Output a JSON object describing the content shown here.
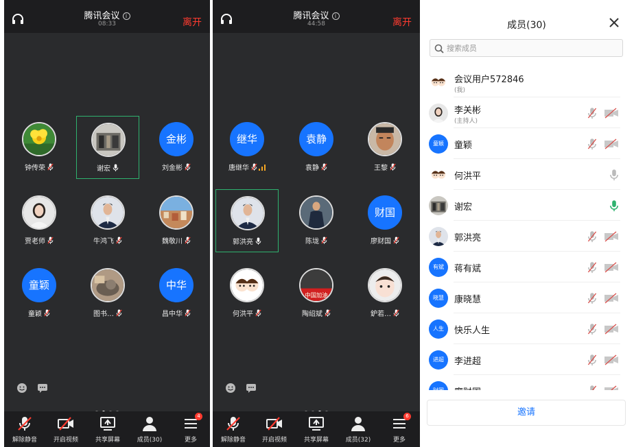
{
  "screen1": {
    "title": "腾讯会议",
    "time": "08:33",
    "leave_label": "离开",
    "participants": [
      {
        "name": "钟传荣",
        "avatar": "flower"
      },
      {
        "name": "谢宏",
        "avatar": "building"
      },
      {
        "name": "刘金彬",
        "avatar_text": "金彬"
      },
      {
        "name": "贾老师",
        "avatar": "woman"
      },
      {
        "name": "牛鸿飞",
        "avatar": "man-suit"
      },
      {
        "name": "魏敬川",
        "avatar": "city"
      },
      {
        "name": "童颖",
        "avatar_text": "童颖"
      },
      {
        "name": "图书…",
        "avatar": "cat"
      },
      {
        "name": "昌中华",
        "avatar_text": "中华"
      }
    ],
    "bottom": {
      "unmute": "解除静音",
      "video": "开启视频",
      "share": "共享屏幕",
      "members": "成员(30)",
      "more": "更多",
      "more_badge": "4"
    }
  },
  "screen2": {
    "title": "腾讯会议",
    "time": "44:58",
    "leave_label": "离开",
    "participants": [
      {
        "name": "唐继华",
        "avatar_text": "继华"
      },
      {
        "name": "袁静",
        "avatar_text": "袁静"
      },
      {
        "name": "王黎",
        "avatar": "man-face"
      },
      {
        "name": "郭洪亮",
        "avatar": "man-suit"
      },
      {
        "name": "陈垅",
        "avatar": "man-standing"
      },
      {
        "name": "廖财国",
        "avatar_text": "财国"
      },
      {
        "name": "何洪平",
        "avatar": "cartoon"
      },
      {
        "name": "陶绍斌",
        "avatar": "poster",
        "avatar_caption": "中国加油"
      },
      {
        "name": "鈩若…",
        "avatar": "child"
      }
    ],
    "bottom": {
      "unmute": "解除静音",
      "video": "开启视频",
      "share": "共享屏幕",
      "members": "成员(32)",
      "more": "更多",
      "more_badge": "6"
    }
  },
  "panel": {
    "title": "成员(30)",
    "search_placeholder": "搜索成员",
    "members": [
      {
        "name": "会议用户572846",
        "sub": "(我)",
        "avatar": "cartoon"
      },
      {
        "name": "李关彬",
        "sub": "(主持人)",
        "avatar": "woman"
      },
      {
        "name": "童颖",
        "avatar_text": "童颖"
      },
      {
        "name": "何洪平",
        "avatar": "cartoon"
      },
      {
        "name": "谢宏",
        "avatar": "building"
      },
      {
        "name": "郭洪亮",
        "avatar": "man-suit"
      },
      {
        "name": "蒋有斌",
        "avatar_text": "有斌"
      },
      {
        "name": "康晓慧",
        "avatar_text": "晓慧"
      },
      {
        "name": "快乐人生",
        "avatar_text": "人生"
      },
      {
        "name": "李进超",
        "avatar_text": "进超"
      },
      {
        "name": "廖财国",
        "avatar_text": "财国"
      }
    ],
    "invite_label": "邀请"
  },
  "colors": {
    "accent": "#1774ff",
    "leave": "#ff3b30",
    "speaking": "#2fb36f",
    "bg": "#2a2b2d"
  }
}
